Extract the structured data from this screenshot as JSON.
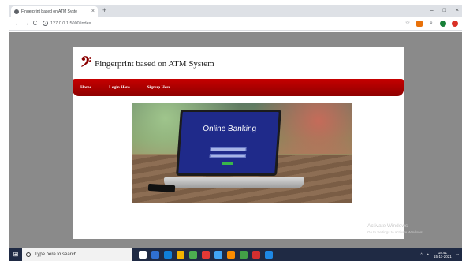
{
  "browser": {
    "tab_title": "Fingerprint based on ATM Syste",
    "tab_close": "×",
    "new_tab": "+",
    "url": "127.0.0.1:5000/index",
    "min_label": "–",
    "max_label": "□",
    "close_label": "×",
    "back": "←",
    "forward": "→",
    "reload": "C"
  },
  "site": {
    "logo_glyph": "𝄢",
    "title": "Fingerprint based on ATM System",
    "nav": [
      "Home",
      "Login Here",
      "Signup Here"
    ],
    "hero_text": "Online Banking",
    "brand_color": "#b30000"
  },
  "os": {
    "watermark_title": "Activate Windows",
    "watermark_sub": "Go to Settings to activate Windows.",
    "search_placeholder": "Type here to search",
    "time": "18:41",
    "date": "15-11-2021"
  }
}
